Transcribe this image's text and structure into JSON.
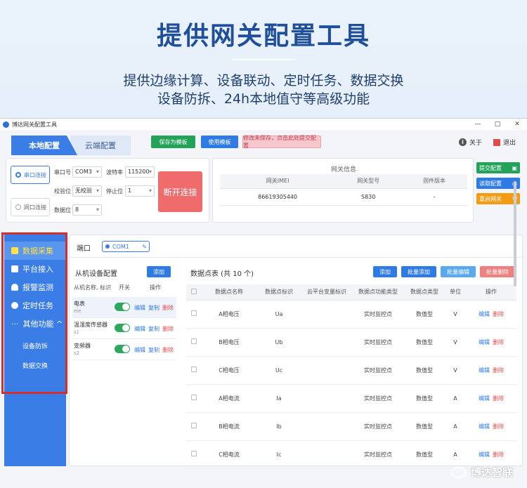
{
  "hero": {
    "title": "提供网关配置工具",
    "subtitle_line1": "提供边缘计算、设备联动、定时任务、数据交换",
    "subtitle_line2": "设备防拆、24h本地值守等高级功能"
  },
  "window": {
    "title": "博达网关配置工具",
    "controls": [
      "—",
      "□",
      "✕"
    ]
  },
  "topbar": {
    "tab_local": "本地配置",
    "tab_cloud": "云端配置",
    "save_template": "保存为模板",
    "use_template": "使用模板",
    "unsaved_notice": "修改未保存，点击此处提交配置",
    "about": "关于",
    "exit": "退出"
  },
  "serial": {
    "serial_connect": "串口连接",
    "network_connect": "网口连接",
    "port_label": "串口号",
    "port_value": "COM3",
    "baud_label": "波特率",
    "baud_value": "115200",
    "parity_label": "校验位",
    "parity_value": "无校验",
    "stopbit_label": "停止位",
    "stopbit_value": "1",
    "databit_label": "数据位",
    "databit_value": "8",
    "disconnect": "断开连接"
  },
  "gateway": {
    "title": "网关信息",
    "headers": [
      "网关IMEI",
      "网关型号",
      "固件版本"
    ],
    "row": [
      "86619305440",
      "S830",
      "-"
    ]
  },
  "side_buttons": {
    "submit": "提交配置",
    "read": "读取配置",
    "restart": "重启网关"
  },
  "nav": {
    "items": [
      "数据采集",
      "平台接入",
      "报警监测",
      "定时任务",
      "其他功能 ^"
    ],
    "subitems": [
      "设备防拆",
      "数据交换"
    ]
  },
  "main": {
    "port_label": "端口",
    "port_chip": "COM1",
    "slave": {
      "title": "从机设备配置",
      "add": "添加",
      "head_name": "从机名称, 标识",
      "head_switch": "开关",
      "head_ops": "操作",
      "rows": [
        {
          "name": "电表",
          "tag": "ele"
        },
        {
          "name": "温湿度传感器",
          "tag": "s1"
        },
        {
          "name": "变频器",
          "tag": "s2"
        }
      ],
      "edit": "编辑",
      "copy": "复制",
      "del": "删除"
    },
    "points": {
      "title": "数据点表 (共 10 个)",
      "add": "添加",
      "batch_add": "批量添加",
      "batch_edit": "批量编辑",
      "batch_del": "批量删除",
      "headers": [
        "数据点名称",
        "数据点标识",
        "云平台变量标识",
        "数据点功能类型",
        "数据点类型",
        "单位",
        "操作"
      ],
      "rows": [
        [
          "A相电压",
          "Ua",
          "",
          "实时监控点",
          "数值型",
          "V"
        ],
        [
          "B相电压",
          "Ub",
          "",
          "实时监控点",
          "数值型",
          "V"
        ],
        [
          "C相电压",
          "Uc",
          "",
          "实时监控点",
          "数值型",
          "V"
        ],
        [
          "A相电流",
          "Ia",
          "",
          "实时监控点",
          "数值型",
          "A"
        ],
        [
          "B相电流",
          "Ib",
          "",
          "实时监控点",
          "数值型",
          "A"
        ],
        [
          "C相电流",
          "Ic",
          "",
          "实时监控点",
          "数值型",
          "A"
        ]
      ],
      "edit": "编辑",
      "del": "删除"
    }
  },
  "watermark": "博达智联"
}
